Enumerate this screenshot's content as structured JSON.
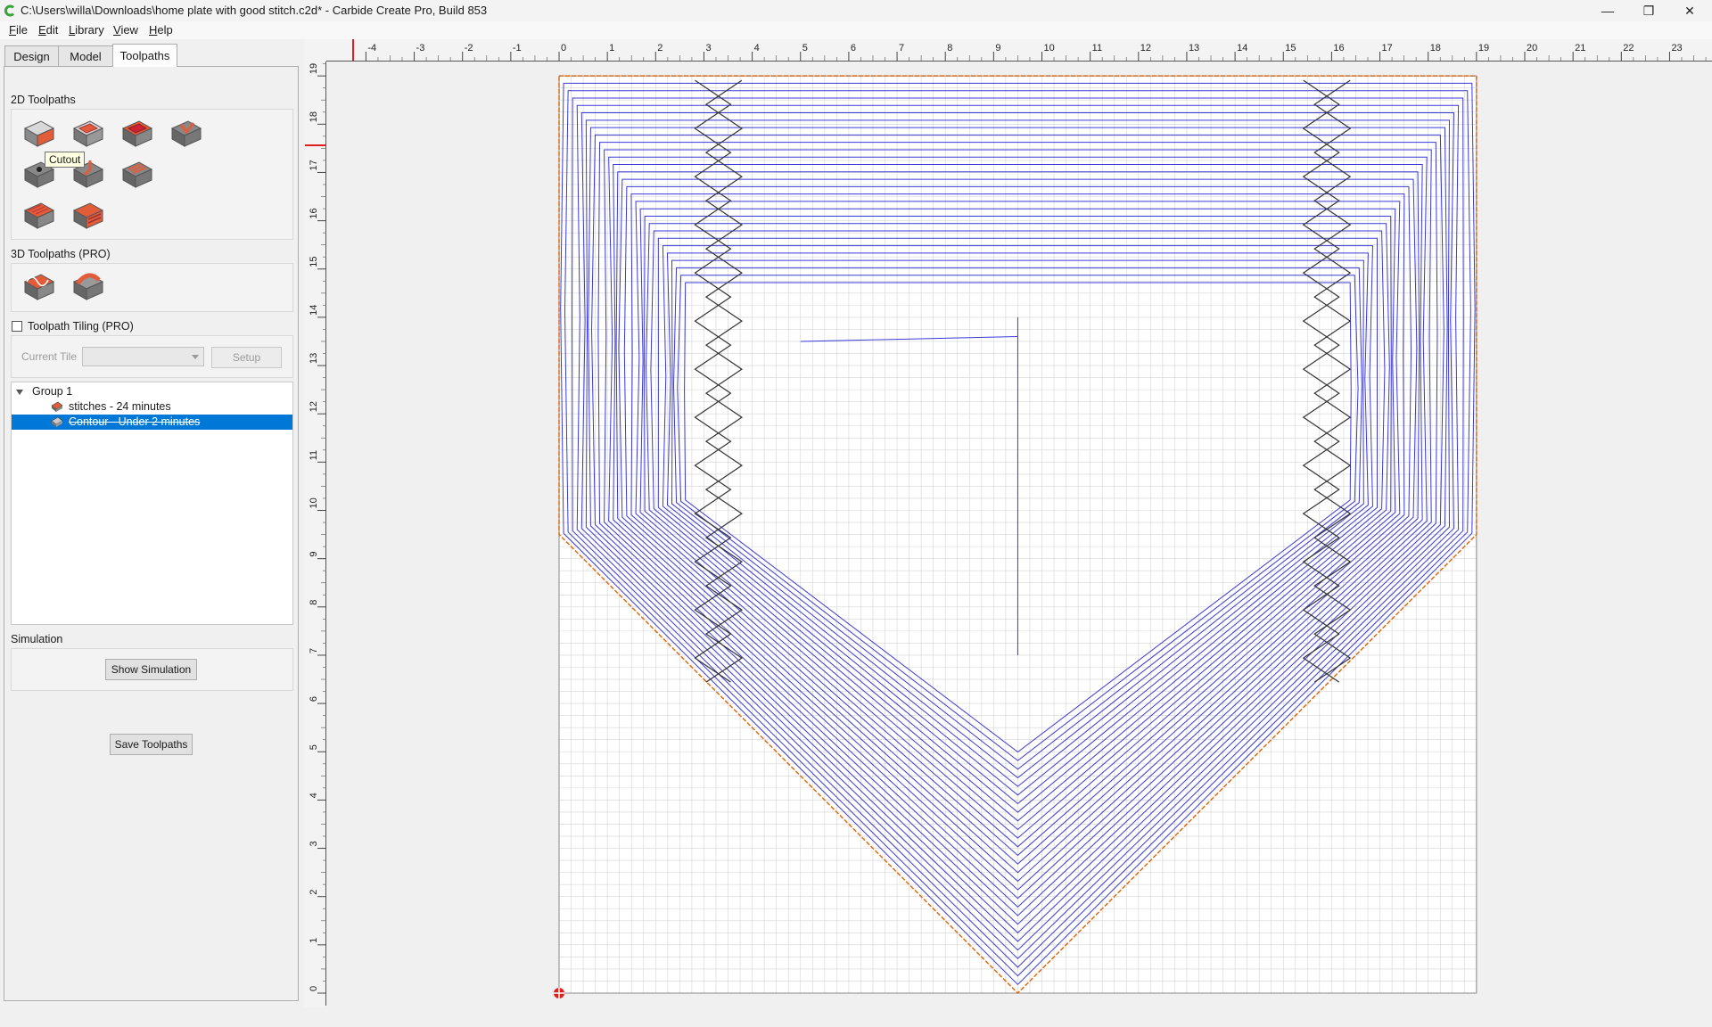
{
  "window": {
    "title": "C:\\Users\\willa\\Downloads\\home plate with good stitch.c2d* - Carbide Create Pro, Build 853",
    "minimize_icon": "minimize-icon",
    "restore_icon": "restore-icon",
    "close_icon": "close-icon",
    "minimize_glyph": "—",
    "restore_glyph": "❐",
    "close_glyph": "✕"
  },
  "menu": {
    "items": [
      "File",
      "Edit",
      "Library",
      "View",
      "Help"
    ]
  },
  "tabs": {
    "items": [
      "Design",
      "Model",
      "Toolpaths"
    ],
    "active": "Toolpaths"
  },
  "toolpaths_2d": {
    "label": "2D Toolpaths",
    "tools": [
      "contour-toolpath-icon",
      "pocket-toolpath-icon",
      "texture-toolpath-icon",
      "vcarve-toolpath-icon",
      "drill-toolpath-icon",
      "advanced-vcarve-icon",
      "adaptive-toolpath-icon",
      "flatten-toolpath-icon",
      "rough-toolpath-icon"
    ],
    "tooltip": "Cutout"
  },
  "toolpaths_3d": {
    "label": "3D Toolpaths (PRO)",
    "tools": [
      "3d-rough-icon",
      "3d-finish-icon"
    ]
  },
  "tiling": {
    "label": "Toolpath Tiling (PRO)",
    "checked": false,
    "current_tile_label": "Current Tile",
    "current_tile_value": "",
    "setup_button": "Setup"
  },
  "tree": {
    "group_label": "Group 1",
    "items": [
      {
        "label": "stitches - 24 minutes",
        "selected": false,
        "disabled": false
      },
      {
        "label": "Contour - Under 2 minutes",
        "selected": true,
        "disabled": true
      }
    ]
  },
  "simulation": {
    "label": "Simulation",
    "show_button": "Show Simulation"
  },
  "save_button": "Save Toolpaths",
  "colors": {
    "accent_selection": "#0078d7",
    "toolpath_blue": "#3a3ad6",
    "stock_outline_orange": "#e36b12",
    "vector_black": "#333333",
    "grid": "#d4d4d4",
    "ruler_marker": "#e02020"
  },
  "rulers": {
    "horizontal_ticks": [
      "-4",
      "-3",
      "-2",
      "-1",
      "0",
      "1",
      "2",
      "3",
      "4",
      "5",
      "6",
      "7",
      "8",
      "9",
      "10",
      "11",
      "12",
      "13",
      "14",
      "15",
      "16",
      "17",
      "18",
      "19",
      "20",
      "21",
      "22",
      "23"
    ],
    "vertical_ticks": [
      "19",
      "18",
      "17",
      "16",
      "15",
      "14",
      "13",
      "12",
      "11",
      "10",
      "9",
      "8",
      "7",
      "6",
      "5",
      "4",
      "3",
      "2",
      "1",
      "0"
    ]
  }
}
